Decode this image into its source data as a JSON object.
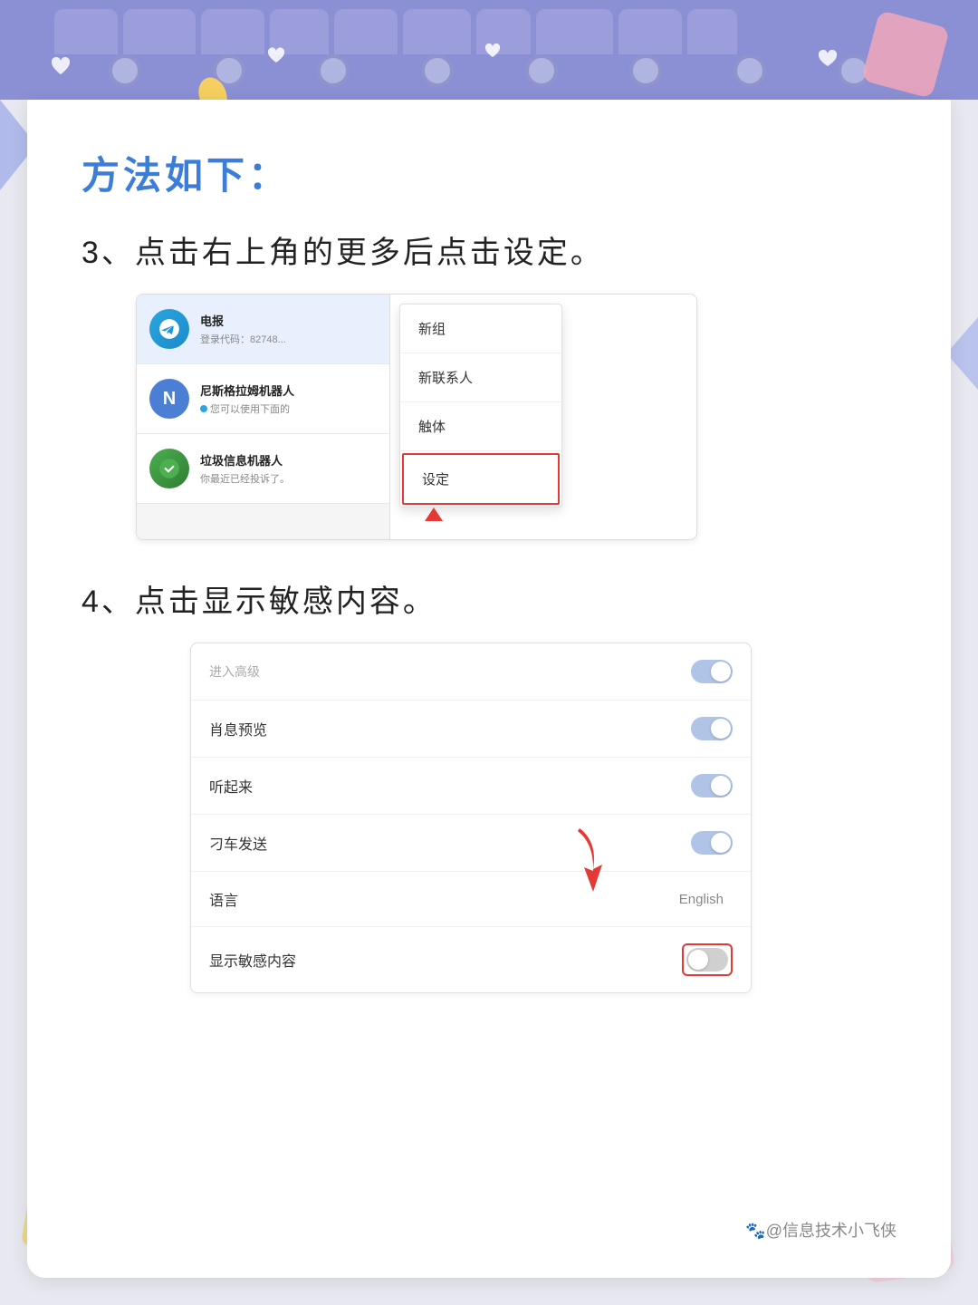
{
  "page": {
    "bg_color": "#e8eaf5",
    "title": "方法如下："
  },
  "header": {
    "binding_color": "#9196d4",
    "tab_count": 10
  },
  "section_title": "方法如下：",
  "step3": {
    "label": "3、点击右上角的更多后点击设定。",
    "chat_items": [
      {
        "name": "电报",
        "preview": "登录代码：82748...",
        "avatar_type": "telegram"
      },
      {
        "name": "尼斯格拉姆机器人",
        "preview": "●您可以使用下面的",
        "avatar_type": "nism"
      },
      {
        "name": "垃圾信息机器人",
        "preview": "你最近已经投诉了。",
        "avatar_type": "spam"
      }
    ],
    "menu_items": [
      {
        "label": "新组",
        "highlighted": false
      },
      {
        "label": "新联系人",
        "highlighted": false
      },
      {
        "label": "触体",
        "highlighted": false
      },
      {
        "label": "设定",
        "highlighted": true
      }
    ]
  },
  "step4": {
    "label": "4、点击显示敏感内容。",
    "settings_rows": [
      {
        "label": "进入高级",
        "faded": true,
        "type": "toggle",
        "state": "on"
      },
      {
        "label": "肖息预览",
        "type": "toggle",
        "state": "on"
      },
      {
        "label": "听起来",
        "type": "toggle",
        "state": "on"
      },
      {
        "label": "刁车发送",
        "type": "toggle",
        "state": "on"
      },
      {
        "label": "语言",
        "type": "value",
        "value": "English"
      },
      {
        "label": "显示敏感内容",
        "type": "toggle",
        "state": "off",
        "highlighted": true
      }
    ]
  },
  "watermark": "🐾@信息技术小飞侠"
}
